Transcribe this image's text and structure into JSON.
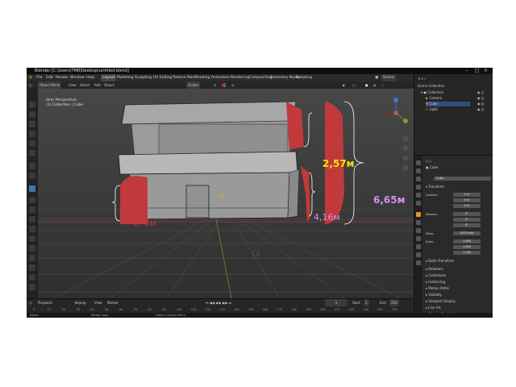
{
  "window": {
    "title": "Blender [C:\\Users\\TM8\\Desktop\\untitled.blend]"
  },
  "menu": {
    "items": [
      "File",
      "Edit",
      "Render",
      "Window",
      "Help"
    ],
    "workspaces": [
      "Layout",
      "Modeling",
      "Sculpting",
      "UV Editing",
      "Texture Paint",
      "Shading",
      "Animation",
      "Rendering",
      "Compositing",
      "Geometry Nodes",
      "Scripting"
    ],
    "active_workspace": "Layout",
    "scene": "Scene",
    "view_layer": "ViewLayer"
  },
  "viewport": {
    "mode": "Object Mode",
    "menus": [
      "View",
      "Select",
      "Add",
      "Object"
    ],
    "orientation": "Global",
    "view_label": "User Perspective",
    "collection_label": "(1) Collection | Cube"
  },
  "outliner": {
    "title": "Scene Collection",
    "items": [
      "Collection",
      "Camera",
      "Cube",
      "Light"
    ]
  },
  "properties": {
    "object_name": "Cube",
    "sections": [
      "Transform",
      "Location",
      "Rotation",
      "Mode",
      "Scale",
      "Delta Transform",
      "Relations",
      "Collections",
      "Instancing",
      "Motion Paths",
      "Visibility",
      "Viewport Display",
      "Line Art",
      "Custom Properties"
    ],
    "rotation_mode": "XYZ Euler",
    "axis_labels": [
      "X",
      "Y",
      "Z"
    ],
    "values": [
      "0 m",
      "0 m",
      "0 m",
      "0°",
      "0°",
      "0°",
      "1.000",
      "1.000",
      "1.000"
    ]
  },
  "timeline": {
    "menus": [
      "Playback",
      "Keying",
      "View",
      "Marker"
    ],
    "current_frame": "1",
    "start_label": "Start",
    "start": "1",
    "end_label": "End",
    "end": "250",
    "ticks": [
      "0",
      "10",
      "20",
      "30",
      "40",
      "50",
      "60",
      "70",
      "80",
      "90",
      "100",
      "110",
      "120",
      "130",
      "140",
      "150",
      "160",
      "170",
      "180",
      "190",
      "200",
      "210",
      "220",
      "230",
      "240",
      "250"
    ]
  },
  "statusbar": {
    "items": [
      "Select",
      "Rotate View",
      "Object Context Menu"
    ]
  },
  "annotations": {
    "dim_1": "2,57м",
    "dim_2": "4,16м",
    "dim_3": "6,65м",
    "dim_4": "2, 6м"
  },
  "colors": {
    "bracket_red": "#c0393b",
    "text_yellow": "#f3e300",
    "text_violet": "#d291f2",
    "accent_blue": "#4772b3",
    "viewport_bg": "#3d3d3d"
  }
}
